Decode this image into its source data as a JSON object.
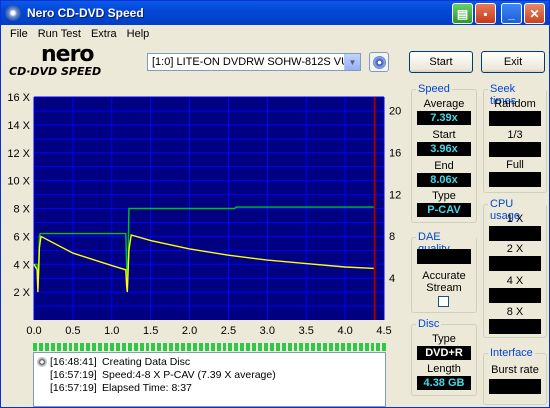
{
  "window": {
    "title": "Nero CD-DVD Speed"
  },
  "menu": [
    "File",
    "Run Test",
    "Extra",
    "Help"
  ],
  "logo": {
    "brand": "nero",
    "product": "CD·DVD SPEED"
  },
  "drive": {
    "selected": "[1:0]  LITE-ON DVDRW SOHW-812S VUS0N"
  },
  "buttons": {
    "start": "Start",
    "exit": "Exit"
  },
  "speed": {
    "title": "Speed",
    "average_label": "Average",
    "average": "7.39x",
    "start_label": "Start",
    "start": "3.96x",
    "end_label": "End",
    "end": "8.06x",
    "type_label": "Type",
    "type": "P-CAV"
  },
  "seek": {
    "title": "Seek times",
    "random": "Random",
    "third": "1/3",
    "full": "Full"
  },
  "cpu": {
    "title": "CPU usage",
    "x1": "1 X",
    "x2": "2 X",
    "x4": "4 X",
    "x8": "8 X"
  },
  "dae": {
    "title": "DAE quality",
    "accurate_stream": "Accurate Stream"
  },
  "disc": {
    "title": "Disc",
    "type_label": "Type",
    "type": "DVD+R",
    "length_label": "Length",
    "length": "4.38 GB"
  },
  "interface": {
    "title": "Interface",
    "burst_rate": "Burst rate"
  },
  "log": [
    {
      "time": "[16:48:41]",
      "text": "Creating Data Disc",
      "icon": "disc-icon"
    },
    {
      "time": "[16:57:19]",
      "text": "Speed:4-8 X P-CAV (7.39 X average)"
    },
    {
      "time": "[16:57:19]",
      "text": "Elapsed Time:  8:37"
    }
  ],
  "colors": {
    "chart_bg": "#000080",
    "grid": "#0000ff",
    "write_speed": "#00c020",
    "read_speed": "#ffff00",
    "end_marker": "#a00000",
    "value_text": "#48d8e8",
    "group_title": "#0046d5",
    "progress": "#2ec84a"
  },
  "chart_data": {
    "type": "line",
    "x_ticks": [
      "0.0",
      "0.5",
      "1.0",
      "1.5",
      "2.0",
      "2.5",
      "3.0",
      "3.5",
      "4.0",
      "4.5"
    ],
    "y_ticks_left": [
      "2 X",
      "4 X",
      "6 X",
      "8 X",
      "10 X",
      "12 X",
      "14 X",
      "16 X"
    ],
    "y_ticks_right": [
      "4",
      "8",
      "12",
      "16",
      "20"
    ],
    "xlim": [
      0,
      4.5
    ],
    "ylim": [
      0,
      16
    ],
    "ylim_right": [
      0,
      21.3
    ],
    "grid": true,
    "end_marker_x": 4.38,
    "series": [
      {
        "color": "#00c020",
        "x": [
          0,
          0.04,
          0.05,
          0.06,
          0.07,
          0.08,
          1.18,
          1.19,
          1.2,
          1.21,
          1.22,
          1.25,
          2.58,
          2.6,
          4.38
        ],
        "y": [
          4.0,
          4.0,
          2.5,
          4.0,
          6.0,
          6.2,
          6.2,
          4.0,
          2.5,
          4.0,
          8.0,
          8.0,
          8.0,
          8.1,
          8.1
        ]
      },
      {
        "color": "#ffff00",
        "x": [
          0,
          0.04,
          0.05,
          0.06,
          0.07,
          0.09,
          0.5,
          1.0,
          1.18,
          1.19,
          1.2,
          1.21,
          1.22,
          1.25,
          1.5,
          2.0,
          2.5,
          3.0,
          3.5,
          4.0,
          4.38
        ],
        "y": [
          4.0,
          3.6,
          2.0,
          3.6,
          5.2,
          6.0,
          4.8,
          3.9,
          3.6,
          2.5,
          2.0,
          3.5,
          5.0,
          6.1,
          5.7,
          5.1,
          4.65,
          4.3,
          4.05,
          3.8,
          3.7
        ]
      }
    ]
  }
}
